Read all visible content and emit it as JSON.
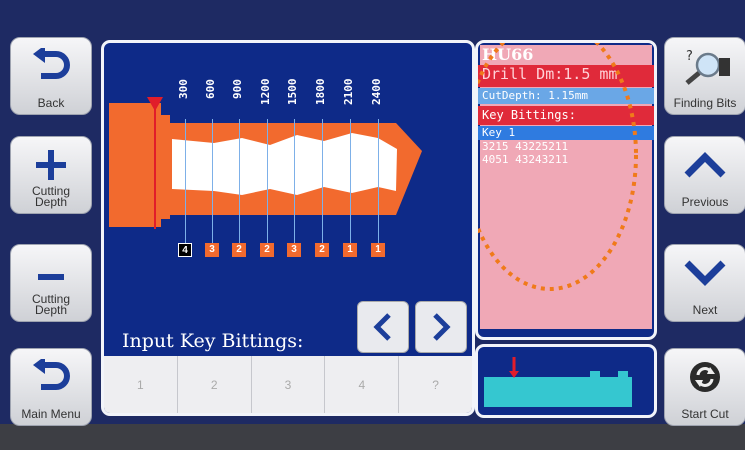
{
  "left_buttons": {
    "back": "Back",
    "cutting_depth_plus": "Cutting\nDepth",
    "cutting_depth_minus": "Cutting\nDepth",
    "main_menu": "Main Menu"
  },
  "right_buttons": {
    "finding_bits": "Finding Bits",
    "previous": "Previous",
    "next": "Next",
    "start_cut": "Start Cut"
  },
  "key_diagram": {
    "depth_labels": [
      "300",
      "600",
      "900",
      "1200",
      "1500",
      "1800",
      "2100",
      "2400"
    ],
    "bittings": [
      "4",
      "3",
      "2",
      "2",
      "3",
      "2",
      "1",
      "1"
    ],
    "selected_bitting_index": 0
  },
  "input": {
    "label": "Input Key Bittings:",
    "cells": [
      "1",
      "2",
      "3",
      "4",
      "?"
    ]
  },
  "info": {
    "key_name": "HU66",
    "drill": "Drill Dm:1.5 mm",
    "cut_depth": "CutDepth: 1.15mm",
    "key_bittings_label": "Key Bittings:",
    "key_row": "Key 1",
    "codes": [
      "3215  43225211",
      "4051  43243211"
    ]
  },
  "colors": {
    "background": "#1e2a63",
    "panel": "#0e2a88",
    "key_orange": "#f26a2e",
    "info_pink": "#f0a8b6",
    "preview_cyan": "#35c7d0",
    "highlight_blue": "#2f7be0",
    "highlight_red": "#e02a3a"
  }
}
